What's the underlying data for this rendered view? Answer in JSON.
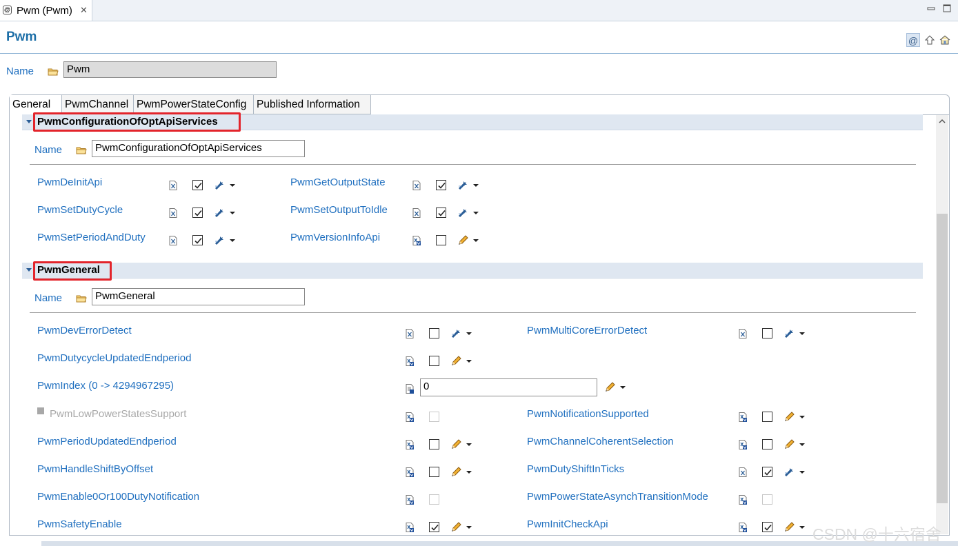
{
  "editor_tab": {
    "title": "Pwm (Pwm)"
  },
  "header": {
    "title": "Pwm"
  },
  "name_row": {
    "label": "Name",
    "value": "Pwm"
  },
  "tabs": [
    {
      "label": "General"
    },
    {
      "label": "PwmChannel"
    },
    {
      "label": "PwmPowerStateConfig"
    },
    {
      "label": "Published Information"
    }
  ],
  "section1": {
    "title": "PwmConfigurationOfOptApiServices",
    "name_label": "Name",
    "name_value": "PwmConfigurationOfOptApiServices",
    "params": [
      {
        "label": "PwmDeInitApi",
        "checked": true,
        "action": "wand"
      },
      {
        "label": "PwmGetOutputState",
        "checked": true,
        "action": "wand"
      },
      {
        "label": "PwmSetDutyCycle",
        "checked": true,
        "action": "wand"
      },
      {
        "label": "PwmSetOutputToIdle",
        "checked": true,
        "action": "wand"
      },
      {
        "label": "PwmSetPeriodAndDuty",
        "checked": true,
        "action": "wand"
      },
      {
        "label": "PwmVersionInfoApi",
        "checked": false,
        "action": "pencil"
      }
    ]
  },
  "section2": {
    "title": "PwmGeneral",
    "name_label": "Name",
    "name_value": "PwmGeneral",
    "params": [
      {
        "label": "PwmDevErrorDetect",
        "checked": false,
        "action": "wand"
      },
      {
        "label": "PwmMultiCoreErrorDetect",
        "checked": false,
        "action": "wand"
      },
      {
        "label": "PwmDutycycleUpdatedEndperiod",
        "checked": false,
        "action": "pencil"
      },
      {
        "label": "PwmIndex (0 -> 4294967295)",
        "value": "0",
        "action": "pencil"
      },
      {
        "label": "PwmLowPowerStatesSupport",
        "checked": false,
        "disabled": true
      },
      {
        "label": "PwmNotificationSupported",
        "checked": false,
        "action": "pencil"
      },
      {
        "label": "PwmPeriodUpdatedEndperiod",
        "checked": false,
        "action": "pencil"
      },
      {
        "label": "PwmChannelCoherentSelection",
        "checked": false,
        "action": "pencil"
      },
      {
        "label": "PwmHandleShiftByOffset",
        "checked": false,
        "action": "pencil"
      },
      {
        "label": "PwmDutyShiftInTicks",
        "checked": true,
        "action": "wand"
      },
      {
        "label": "PwmEnable0Or100DutyNotification",
        "checked": false,
        "disabled": true
      },
      {
        "label": "PwmPowerStateAsynchTransitionMode",
        "checked": false,
        "disabled": true
      },
      {
        "label": "PwmSafetyEnable",
        "checked": true,
        "action": "pencil"
      },
      {
        "label": "PwmInitCheckApi",
        "checked": true,
        "action": "pencil"
      }
    ]
  },
  "watermark": "CSDN @十六宿舍",
  "colors": {
    "link": "#1f6fbf",
    "title": "#1c6ea7",
    "highlight": "#e3242b",
    "section_bar": "#dfe7f1"
  },
  "icons": [
    "file-icon",
    "close-icon",
    "minimize-icon",
    "maximize-icon",
    "at-icon",
    "up-arrow-icon",
    "home-icon",
    "folder-icon",
    "variant-icon",
    "wand-icon",
    "pencil-icon",
    "dropdown-arrow-icon"
  ]
}
